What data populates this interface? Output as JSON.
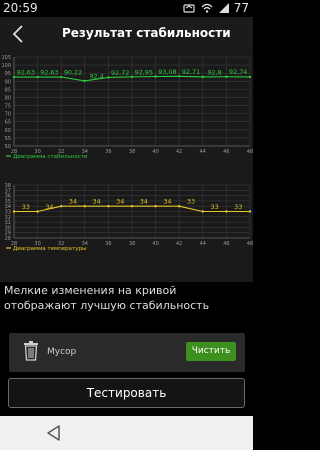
{
  "status_bar": {
    "time": "20:59",
    "battery": "77"
  },
  "app_bar": {
    "title": "Результат стабильности"
  },
  "stability_chart": {
    "y_ticks": [
      "105",
      "100",
      "95",
      "90",
      "85",
      "80",
      "75",
      "70",
      "65",
      "60",
      "55",
      "50"
    ],
    "x_ticks": [
      "28",
      "30",
      "32",
      "34",
      "36",
      "38",
      "40",
      "42",
      "44",
      "46",
      "48"
    ],
    "legend": "Диаграмма стабильности",
    "color": "#2ecc40"
  },
  "temperature_chart": {
    "y_ticks": [
      "38",
      "37",
      "36",
      "35",
      "34",
      "33",
      "32",
      "31",
      "30",
      "29",
      "28"
    ],
    "x_ticks": [
      "28",
      "30",
      "32",
      "34",
      "36",
      "38",
      "40",
      "42",
      "44",
      "46",
      "48"
    ],
    "legend": "Диаграмма температуры",
    "color": "#e8c82a"
  },
  "chart_data": [
    {
      "type": "line",
      "x": [
        28,
        30,
        32,
        34,
        36,
        38,
        40,
        42,
        44,
        46,
        48
      ],
      "series": [
        {
          "name": "Диаграмма стабильности",
          "values": [
            92.63,
            92.63,
            92.63,
            90.22,
            92.4,
            92.72,
            92.95,
            93.08,
            92.71,
            92.8,
            92.7
          ]
        }
      ],
      "labels": [
        "92,63",
        "92,63",
        "90,22",
        "92,4",
        "92,72",
        "92,95",
        "93,08",
        "92,71",
        "92,8",
        "92,74"
      ],
      "xlabel": "",
      "ylabel": "",
      "xlim": [
        28,
        48
      ],
      "ylim": [
        50,
        105
      ],
      "grid": true,
      "legend_position": "bottom-left"
    },
    {
      "type": "line",
      "x": [
        28,
        30,
        32,
        34,
        36,
        38,
        40,
        42,
        44,
        46,
        48
      ],
      "series": [
        {
          "name": "Диаграмма температуры",
          "values": [
            33,
            33,
            34,
            34,
            34,
            34,
            34,
            34,
            33,
            33,
            33
          ]
        }
      ],
      "labels": [
        "33",
        "34",
        "34",
        "34",
        "34",
        "34",
        "34",
        "33",
        "33",
        "33"
      ],
      "xlabel": "",
      "ylabel": "",
      "xlim": [
        28,
        48
      ],
      "ylim": [
        28,
        38
      ],
      "grid": true,
      "legend_position": "bottom-left"
    }
  ],
  "note": "Мелкие изменения на кривой отображают лучшую стабильность",
  "trash": {
    "label": "Мусор",
    "button": "Чистить"
  },
  "test_button": "Тестировать"
}
